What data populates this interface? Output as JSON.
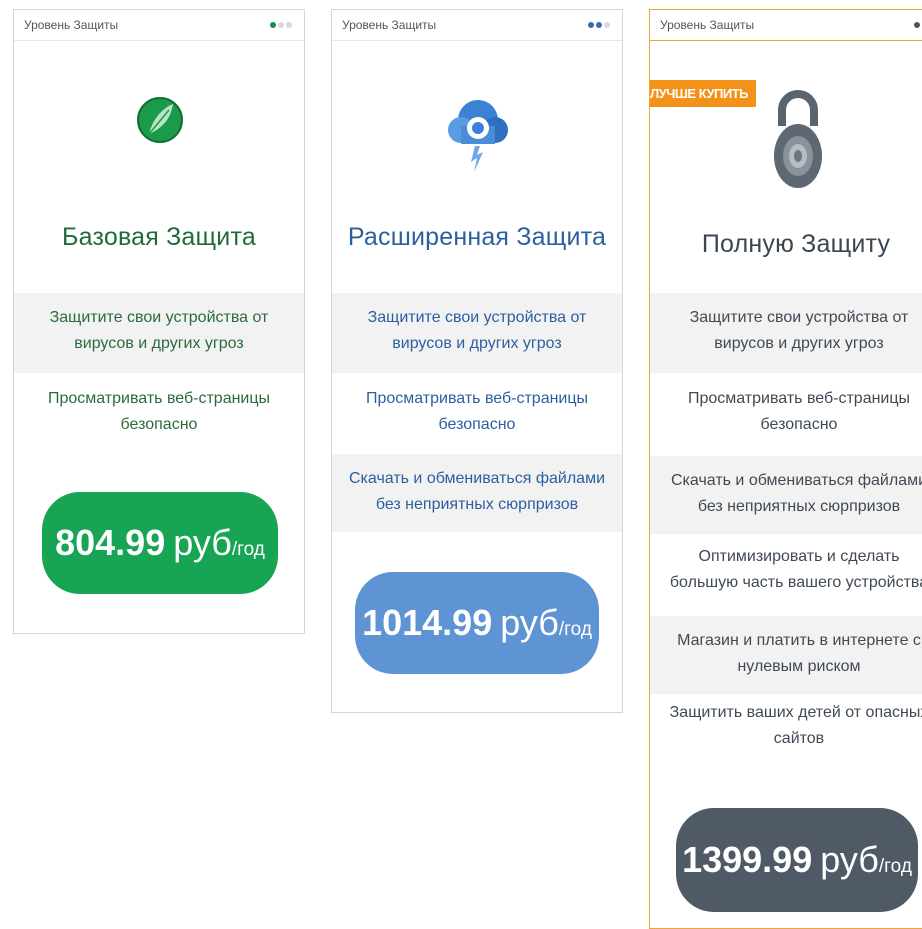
{
  "cards": [
    {
      "level_label": "Уровень Защиты",
      "title": "Базовая Защита",
      "icon": "green-leaf-icon",
      "features": [
        "Защитите свои устройства от\nвирусов и других угроз",
        "Просматривать веб-страницы\nбезопасно"
      ],
      "price": {
        "amount": "804.99",
        "currency": "руб",
        "per": "/год"
      },
      "accent": "#17a454"
    },
    {
      "level_label": "Уровень Защиты",
      "title": "Расширенная Защита",
      "icon": "blue-cloud-icon",
      "features": [
        "Защитите свои устройства от\nвирусов и других угроз",
        "Просматривать веб-страницы\nбезопасно",
        "Скачать и обмениваться файлами\nбез неприятных сюрпризов"
      ],
      "price": {
        "amount": "1014.99",
        "currency": "руб",
        "per": "/год"
      },
      "accent": "#5f94d4"
    },
    {
      "level_label": "Уровень Защиты",
      "badge": "ЛУЧШЕ КУПИТЬ",
      "title": "Полную Защиту",
      "icon": "padlock-icon",
      "features": [
        "Защитите свои устройства от\nвирусов и других угроз",
        "Просматривать веб-страницы\nбезопасно",
        "Скачать и обмениваться файлами\nбез неприятных сюрпризов",
        "Оптимизировать и сделать\nбольшую часть вашего устройства",
        "Магазин и платить в интернете с\nнулевым риском",
        "Защитить ваших детей от опасных\nсайтов"
      ],
      "price": {
        "amount": "1399.99",
        "currency": "руб",
        "per": "/год"
      },
      "accent": "#505a66"
    }
  ]
}
